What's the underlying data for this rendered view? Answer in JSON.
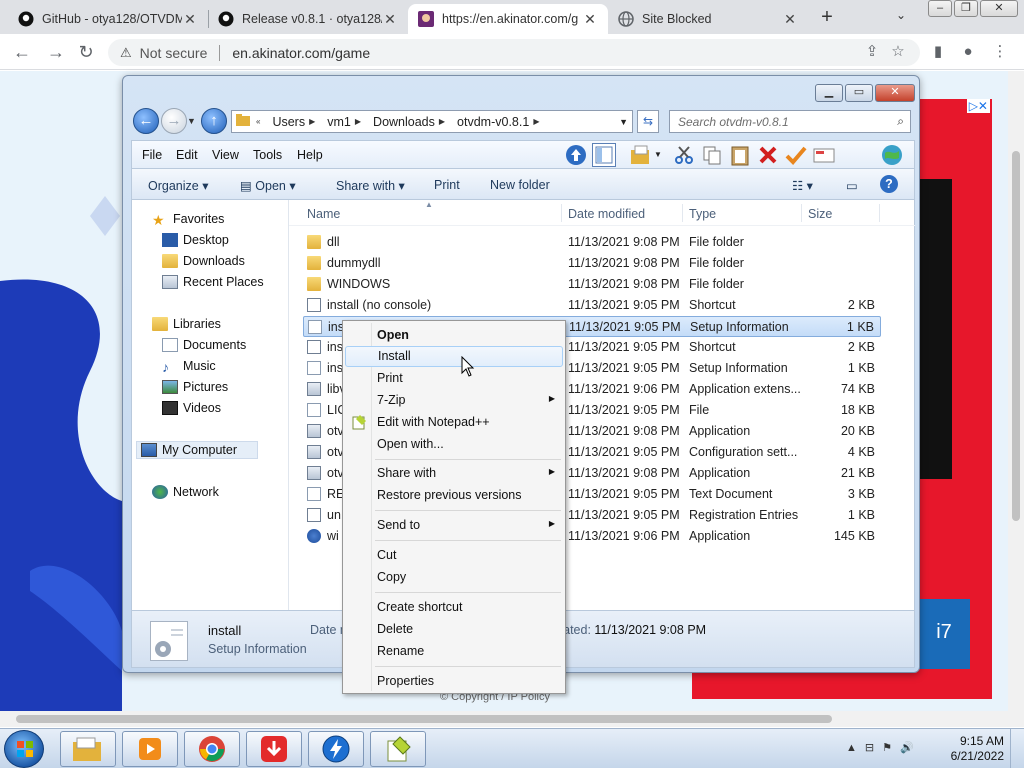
{
  "browser": {
    "tabs": [
      {
        "title": "GitHub - otya128/OTVDM",
        "icon": "github-icon"
      },
      {
        "title": "Release v0.8.1 · otya128/v",
        "icon": "github-icon"
      },
      {
        "title": "https://en.akinator.com/g",
        "icon": "akinator-icon"
      },
      {
        "title": "Site Blocked",
        "icon": "globe-icon"
      }
    ],
    "security_label": "Not secure",
    "url": "en.akinator.com/game"
  },
  "webpage": {
    "copyright": "© Copyright / IP Policy"
  },
  "explorer": {
    "path": [
      "Users",
      "vm1",
      "Downloads",
      "otvdm-v0.8.1"
    ],
    "search_placeholder": "Search otvdm-v0.8.1",
    "menu": [
      "File",
      "Edit",
      "View",
      "Tools",
      "Help"
    ],
    "commands": {
      "organize": "Organize",
      "open": "Open",
      "share_with": "Share with",
      "print": "Print",
      "new_folder": "New folder"
    },
    "nav": {
      "favorites": "Favorites",
      "favorites_items": [
        "Desktop",
        "Downloads",
        "Recent Places"
      ],
      "libraries": "Libraries",
      "libraries_items": [
        "Documents",
        "Music",
        "Pictures",
        "Videos"
      ],
      "computer": "My Computer",
      "network": "Network"
    },
    "columns": {
      "name": "Name",
      "date": "Date modified",
      "type": "Type",
      "size": "Size"
    },
    "files": [
      {
        "name": "dll",
        "date": "11/13/2021 9:08 PM",
        "type": "File folder",
        "size": "",
        "icon": "folder"
      },
      {
        "name": "dummydll",
        "date": "11/13/2021 9:08 PM",
        "type": "File folder",
        "size": "",
        "icon": "folder"
      },
      {
        "name": "WINDOWS",
        "date": "11/13/2021 9:08 PM",
        "type": "File folder",
        "size": "",
        "icon": "folder"
      },
      {
        "name": "install (no console)",
        "date": "11/13/2021 9:05 PM",
        "type": "Shortcut",
        "size": "2 KB",
        "icon": "short"
      },
      {
        "name": "ins",
        "date": "11/13/2021 9:05 PM",
        "type": "Setup Information",
        "size": "1 KB",
        "icon": "doc"
      },
      {
        "name": "ins",
        "date": "11/13/2021 9:05 PM",
        "type": "Shortcut",
        "size": "2 KB",
        "icon": "short"
      },
      {
        "name": "ins",
        "date": "11/13/2021 9:05 PM",
        "type": "Setup Information",
        "size": "1 KB",
        "icon": "doc"
      },
      {
        "name": "libv",
        "date": "11/13/2021 9:06 PM",
        "type": "Application extens...",
        "size": "74 KB",
        "icon": "app"
      },
      {
        "name": "LIC",
        "date": "11/13/2021 9:05 PM",
        "type": "File",
        "size": "18 KB",
        "icon": "doc"
      },
      {
        "name": "otv",
        "date": "11/13/2021 9:08 PM",
        "type": "Application",
        "size": "20 KB",
        "icon": "app"
      },
      {
        "name": "otv",
        "date": "11/13/2021 9:05 PM",
        "type": "Configuration sett...",
        "size": "4 KB",
        "icon": "app"
      },
      {
        "name": "otv",
        "date": "11/13/2021 9:08 PM",
        "type": "Application",
        "size": "21 KB",
        "icon": "app"
      },
      {
        "name": "REA",
        "date": "11/13/2021 9:05 PM",
        "type": "Text Document",
        "size": "3 KB",
        "icon": "doc"
      },
      {
        "name": "un",
        "date": "11/13/2021 9:05 PM",
        "type": "Registration Entries",
        "size": "1 KB",
        "icon": "short"
      },
      {
        "name": "wi",
        "date": "11/13/2021 9:06 PM",
        "type": "Application",
        "size": "145 KB",
        "icon": "help"
      }
    ],
    "details": {
      "name": "install",
      "type": "Setup Information",
      "date_label": "Date m",
      "created_label": "reated:",
      "created_value": "11/13/2021 9:08 PM"
    }
  },
  "context_menu": {
    "open": "Open",
    "install": "Install",
    "print": "Print",
    "zip": "7-Zip",
    "notepad": "Edit with Notepad++",
    "open_with": "Open with...",
    "share_with": "Share with",
    "restore": "Restore previous versions",
    "send_to": "Send to",
    "cut": "Cut",
    "copy": "Copy",
    "create_shortcut": "Create shortcut",
    "delete": "Delete",
    "rename": "Rename",
    "properties": "Properties"
  },
  "taskbar": {
    "time": "9:15 AM",
    "date": "6/21/2022"
  }
}
